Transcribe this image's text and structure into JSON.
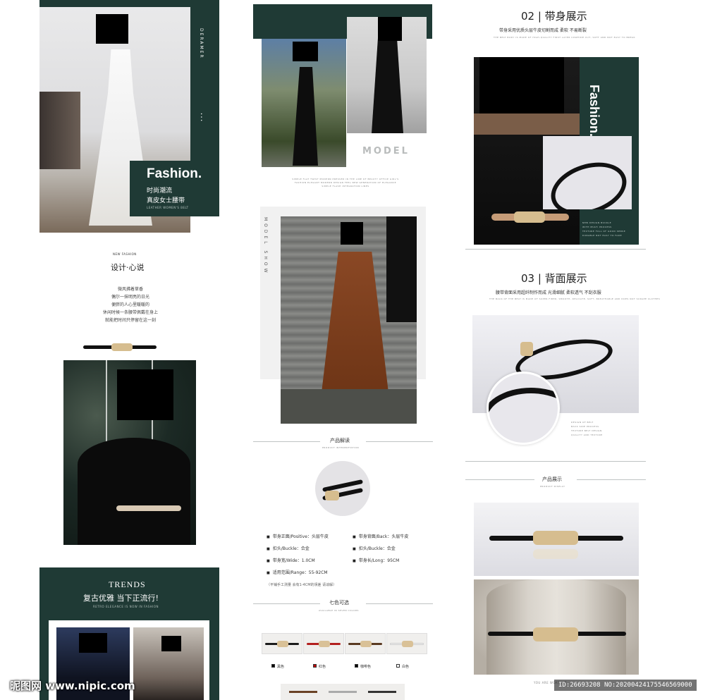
{
  "col1": {
    "hero": {
      "side_tag": "DERAMER",
      "side_dots": "• • •",
      "fashion": "Fashion.",
      "sub1": "时尚潮流",
      "sub2": "真皮女士腰带",
      "sub3": "LEATHER WOMEN'S BELT"
    },
    "design": {
      "badge": "NEW FASHION",
      "title": "设计·心说",
      "lines": [
        "微风拂着草香",
        "偶尔一抹明亮的日光",
        "便胖的人心里暖暖的",
        "休闲时候一条腰带佩戴在身上",
        "就能把时间只停留在这一刻"
      ]
    },
    "trends": {
      "title": "TRENDS",
      "subtitle": "复古优雅 当下正流行!",
      "caption": "RETRO ELEGANCE IS NOW IN FASHION"
    }
  },
  "col2": {
    "model_label": "MODEL",
    "model_caption_1": "SIMPLE FLAT TWIST MODERN PRESSED IN THE LINE OF BEAUTY OFFICE GIRL'S",
    "model_caption_2": "FASHION ELEGANT MODERN DESIGN FEEL NEW GENERATION OF ELEGANCE",
    "model_caption_3": "SIMPLE FLASH INTEGRATION LINES",
    "model_show": "MODEL SHOW",
    "interpretation": {
      "title": "产品解读",
      "subtitle": "PRODUCT INTERPRETATION",
      "specs": [
        "带身正面/Positive：头层牛皮",
        "带身背面/Back：头层牛皮",
        "扣头/Buckle：合金",
        "扣头/Buckle：合金",
        "带身宽/Wide：1.0CM",
        "带身长/Long：95CM",
        "适用范围/Range：55-92CM"
      ],
      "note": "（平铺手工测量 会有1-4CM的误差 请谅解）"
    },
    "colors": {
      "title": "七色可选",
      "subtitle": "AVAILABLE IN SEVEN COLORS",
      "items": [
        {
          "label": "黑色",
          "strap": "#1b1b1b",
          "marker": "#000000"
        },
        {
          "label": "红色",
          "strap": "#b3201f",
          "marker": "#c00000"
        },
        {
          "label": "咖啡色",
          "strap": "#5a3a22",
          "marker": "#000000"
        },
        {
          "label": "白色",
          "strap": "#f4f4f4",
          "marker": "#ffffff"
        }
      ]
    }
  },
  "col3": {
    "sec02": {
      "title": "02 | 带身展示",
      "subtitle": "带身采用优质头层牛皮切割而成 柔软 不易断裂",
      "caption": "THE BELT BODY IS MADE OF HIGH-QUALITY FIRST LAYER COWHIDE CUT, SOFT AND NOT EASY TO BREAK",
      "fashion_vert": "Fashion.",
      "notes": [
        "NEW DESIGN BUCKLE",
        "WITH MULTI PROCESS",
        "TEXTURE FULL OF GOOD SENSE",
        "DURABLE NOT EASY TO FADE"
      ]
    },
    "sec03": {
      "title": "03 | 背面展示",
      "subtitle": "腰带背面采用超纤制作而成 光滑细腻 柔软透气 不刮衣服",
      "caption": "THE BACK OF THE BELT IS MADE OF SUPER FIBER, SMOOTH, DELICATE, SOFT, BREATHABLE AND DOES NOT SCRAPE CLOTHES",
      "notes": [
        "DESIGN OF BELT",
        "BACK SIDE PROCESS",
        "TEXTURE BELT DESIGN",
        "QUALITY AND TEXTURE"
      ]
    },
    "display": {
      "title": "产品展示",
      "subtitle": "PRODUCT DISPLAY",
      "footer": "YOU ARE WORTH IT"
    }
  },
  "watermark": {
    "left": "昵图网 www.nipic.com",
    "right": "ID:26693208 NO:20200424175546569000"
  },
  "colors": {
    "accent_green": "#1f3a35",
    "leather_brown": "#7a3d1f",
    "gold": "#d6bd8f"
  }
}
